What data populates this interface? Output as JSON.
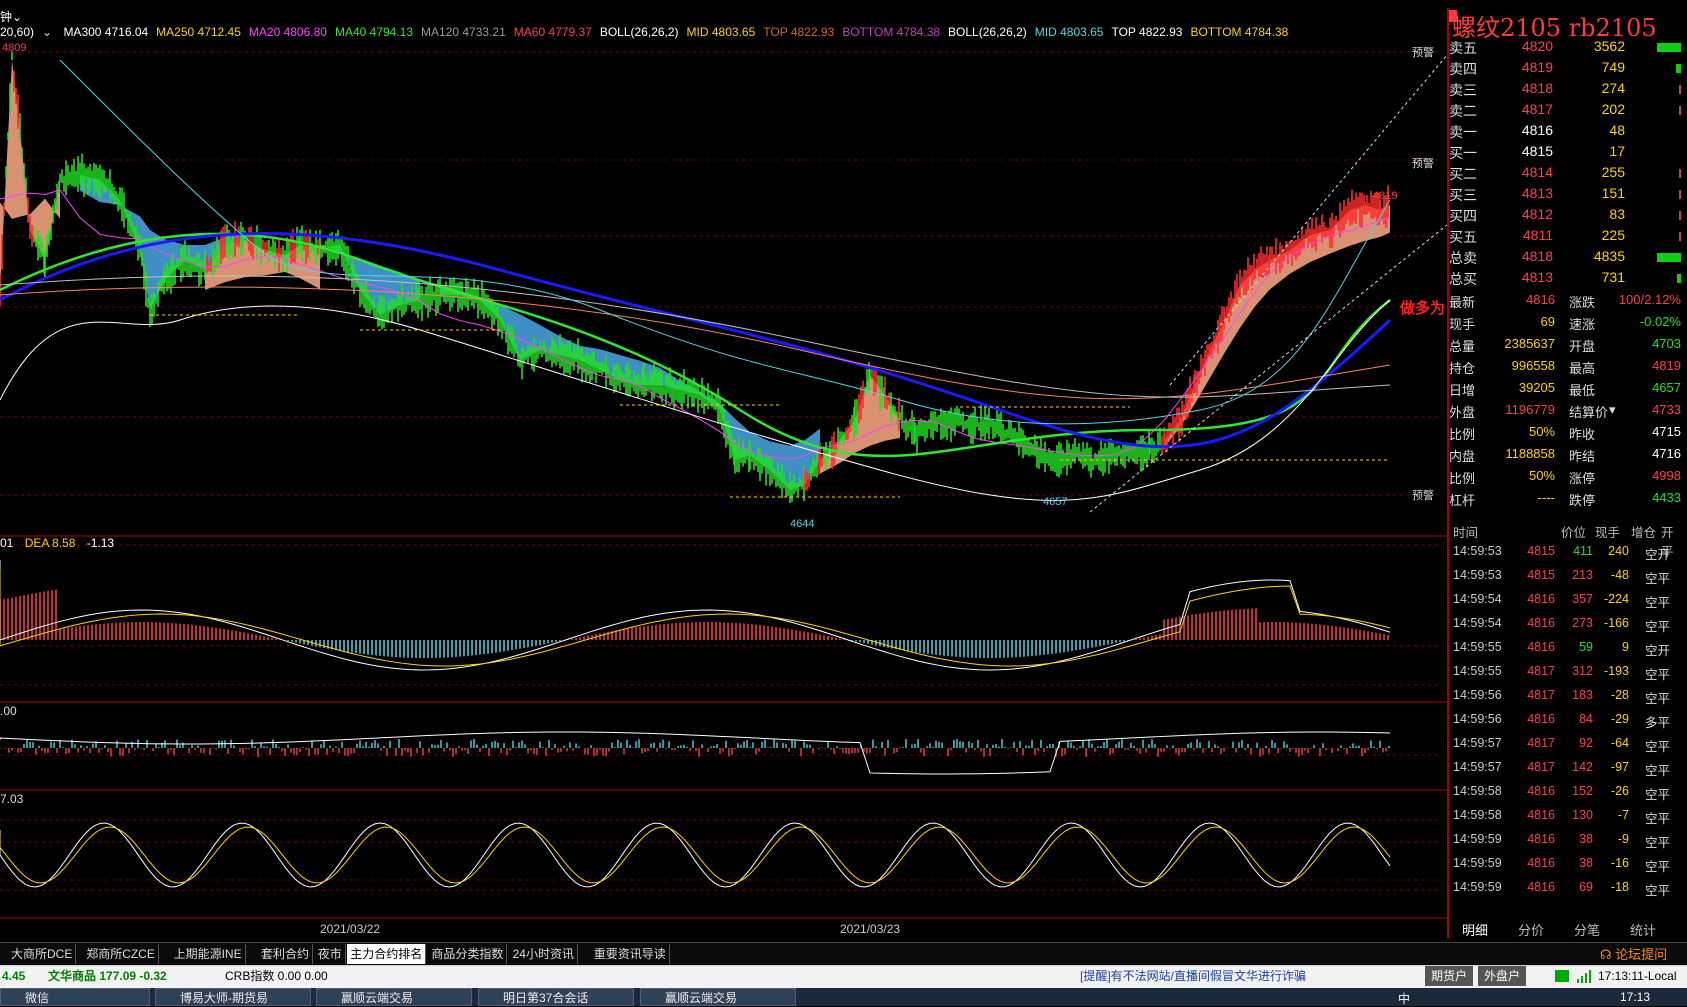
{
  "header": {
    "period": "钟",
    "period_param": "20,60)",
    "indicators": [
      {
        "text": "MA300 4716.04",
        "color": "#ffffff"
      },
      {
        "text": "MA250 4712.45",
        "color": "#ffd200"
      },
      {
        "text": "MA20 4806.80",
        "color": "#ff40ff"
      },
      {
        "text": "MA40 4794.13",
        "color": "#2ee82e"
      },
      {
        "text": "MA120 4733.21",
        "color": "#9a9a9a"
      },
      {
        "text": "MA60 4779.37",
        "color": "#ff4040"
      },
      {
        "text": "BOLL(26,26,2)",
        "color": "#ffffff"
      },
      {
        "text": "MID 4803.65",
        "color": "#ffd200"
      },
      {
        "text": "TOP 4822.93",
        "color": "#d2691e"
      },
      {
        "text": "BOTTOM 4784.38",
        "color": "#c040c0"
      },
      {
        "text": "BOLL(26,26,2)",
        "color": "#ffffff"
      },
      {
        "text": "MID 4803.65",
        "color": "#4fd6e8"
      },
      {
        "text": "TOP 4822.93",
        "color": "#ffffff"
      },
      {
        "text": "BOTTOM 4784.38",
        "color": "#ffd200"
      }
    ]
  },
  "chart_labels": {
    "high_left": "4809",
    "low1": "4644",
    "low2": "4657",
    "high_right": "4819",
    "warn": "预警",
    "side_note": "做多为"
  },
  "macd": {
    "label_dif": "01",
    "label_dea": "DEA 8.58",
    "label_macd": "-1.13"
  },
  "pane3": {
    "label": ".00"
  },
  "pane4": {
    "label": "7.03"
  },
  "dates": [
    "2021/03/22",
    "2021/03/23"
  ],
  "quote": {
    "title": "螺纹2105  rb2105",
    "asks": [
      {
        "label": "卖五",
        "price": "4820",
        "vol": "3562",
        "bar": 1.0
      },
      {
        "label": "卖四",
        "price": "4819",
        "vol": "749",
        "bar": 0.2
      },
      {
        "label": "卖三",
        "price": "4818",
        "vol": "274",
        "bar": 0.07
      },
      {
        "label": "卖二",
        "price": "4817",
        "vol": "202",
        "bar": 0.06
      },
      {
        "label": "卖一",
        "price": "4816",
        "vol": "48",
        "bar": 0.0
      }
    ],
    "bids": [
      {
        "label": "买一",
        "price": "4815",
        "vol": "17",
        "bar": 0.0
      },
      {
        "label": "买二",
        "price": "4814",
        "vol": "255",
        "bar": 0.07
      },
      {
        "label": "买三",
        "price": "4813",
        "vol": "151",
        "bar": 0.04
      },
      {
        "label": "买四",
        "price": "4812",
        "vol": "83",
        "bar": 0.02
      },
      {
        "label": "买五",
        "price": "4811",
        "vol": "225",
        "bar": 0.06
      }
    ],
    "total_sell": {
      "label": "总卖",
      "price": "4818",
      "vol": "4835",
      "bar": 1.0
    },
    "total_buy": {
      "label": "总买",
      "price": "4813",
      "vol": "731",
      "bar": 0.15
    },
    "stats": [
      [
        "最新",
        "4816",
        "涨跌",
        "100/2.12%"
      ],
      [
        "现手",
        "69",
        "速涨",
        "-0.02%"
      ],
      [
        "总量",
        "2385637",
        "开盘",
        "4703"
      ],
      [
        "持仓",
        "996558",
        "最高",
        "4819"
      ],
      [
        "日增",
        "39205",
        "最低",
        "4657"
      ],
      [
        "外盘",
        "1196779",
        "结算价",
        "4733"
      ],
      [
        "比例",
        "50%",
        "昨收",
        "4715"
      ],
      [
        "内盘",
        "1188858",
        "昨结",
        "4716"
      ],
      [
        "比例",
        "50%",
        "涨停",
        "4998"
      ],
      [
        "杠杆",
        "----",
        "跌停",
        "4433"
      ]
    ],
    "tick_header": [
      "时间",
      "价位",
      "现手",
      "增仓",
      "开平"
    ],
    "ticks": [
      [
        "14:59:53",
        "4815",
        "411",
        "240",
        "空开"
      ],
      [
        "14:59:53",
        "4815",
        "213",
        "-48",
        "空平"
      ],
      [
        "14:59:54",
        "4816",
        "357",
        "-224",
        "空平"
      ],
      [
        "14:59:54",
        "4816",
        "273",
        "-166",
        "空平"
      ],
      [
        "14:59:55",
        "4816",
        "59",
        "9",
        "空开"
      ],
      [
        "14:59:55",
        "4817",
        "312",
        "-193",
        "空平"
      ],
      [
        "14:59:56",
        "4817",
        "183",
        "-28",
        "空平"
      ],
      [
        "14:59:56",
        "4816",
        "84",
        "-29",
        "多平"
      ],
      [
        "14:59:57",
        "4817",
        "92",
        "-64",
        "空平"
      ],
      [
        "14:59:57",
        "4817",
        "142",
        "-97",
        "空平"
      ],
      [
        "14:59:58",
        "4816",
        "152",
        "-26",
        "空平"
      ],
      [
        "14:59:58",
        "4816",
        "130",
        "-7",
        "空平"
      ],
      [
        "14:59:59",
        "4816",
        "38",
        "-9",
        "空平"
      ],
      [
        "14:59:59",
        "4816",
        "38",
        "-16",
        "空平"
      ],
      [
        "14:59:59",
        "4816",
        "69",
        "-18",
        "空平"
      ]
    ],
    "sub_tabs": [
      "明细",
      "分价",
      "分笔",
      "统计"
    ]
  },
  "tabs": [
    "大商所DCE",
    "郑商所CZCE",
    "上期能源INE",
    "套利合约",
    "夜市",
    "主力合约排名",
    "商品分类指数",
    "24小时资讯",
    "重要资讯导读"
  ],
  "active_tab": "主力合约排名",
  "forum": "论坛提问",
  "status": {
    "left_num": "4.45",
    "index1": "文华商品  177.09  -0.32",
    "index2": "CRB指数   0.00  0.00",
    "notice": "[提醒]有不法网站/直播间假冒文华进行诈骗",
    "btn1": "期货户",
    "btn2": "外盘户",
    "clock": "17:13:11-Local"
  },
  "taskbar": {
    "items": [
      "微信",
      "博易大师-期货易",
      "赢顺云端交易",
      "明日第37合会话",
      "赢顺云端交易"
    ],
    "time": "17:13",
    "ime": "中"
  }
}
